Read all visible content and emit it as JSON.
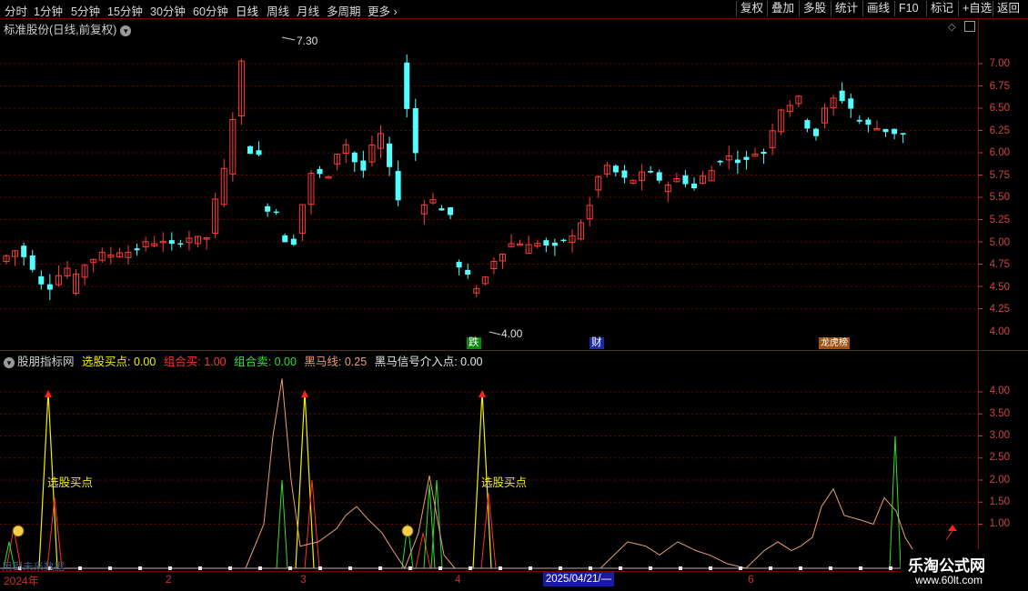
{
  "toolbar": {
    "periods": [
      "分时",
      "1分钟",
      "5分钟",
      "15分钟",
      "30分钟",
      "60分钟",
      "日线",
      "周线",
      "月线",
      "多周期",
      "更多"
    ],
    "active_period": "日线",
    "buttons": [
      "复权",
      "叠加",
      "多股",
      "统计",
      "画线",
      "F10",
      "标记",
      "+自选",
      "返回"
    ]
  },
  "price_pane": {
    "title": "标准股份(日线,前复权)",
    "axis_ticks": [
      "7.00",
      "6.75",
      "6.50",
      "6.25",
      "6.00",
      "5.75",
      "5.50",
      "5.25",
      "5.00",
      "4.75",
      "4.50",
      "4.25",
      "4.00"
    ],
    "high_label": "7.30",
    "low_label": "4.00",
    "tags": [
      "跌",
      "财",
      "龙虎榜"
    ],
    "colors": {
      "up": "#ff3b3b",
      "down": "#54ffff",
      "grid": "#6e0000"
    }
  },
  "indicator_pane": {
    "name": "股朋指标网",
    "items": [
      {
        "label": "选股买点",
        "value": "0.00",
        "color": "#f0f000"
      },
      {
        "label": "组合买",
        "value": "1.00",
        "color": "#ff3030"
      },
      {
        "label": "组合卖",
        "value": "0.00",
        "color": "#30e030"
      },
      {
        "label": "黑马线",
        "value": "0.25",
        "color": "#e8a070"
      },
      {
        "label": "黑马信号介入点",
        "value": "0.00",
        "color": "#e8e8e8"
      }
    ],
    "axis_ticks": [
      "4.00",
      "3.50",
      "3.00",
      "2.50",
      "2.00",
      "1.50",
      "1.00"
    ],
    "annotations": [
      "选股买点",
      "选股买点"
    ],
    "footer_text": "用到未来数据"
  },
  "time_axis": {
    "labels": [
      "2024年",
      "2",
      "3",
      "4",
      "6"
    ],
    "selected_date": "2025/04/21/—"
  },
  "watermark": {
    "title": "乐淘公式网",
    "url": "www.60lt.com"
  }
}
